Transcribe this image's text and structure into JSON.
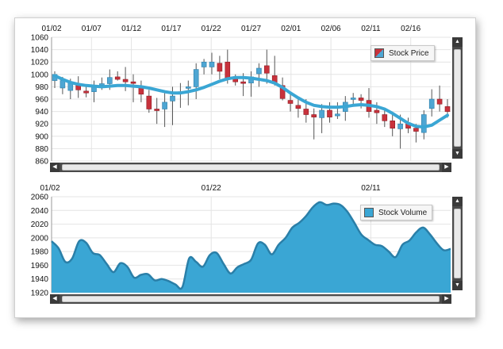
{
  "colors": {
    "up": "#4ea6d3",
    "down": "#c8323c",
    "trend": "#3aa6d4",
    "area": "#3aa6d4",
    "areaStroke": "#2a7fa8",
    "grid": "#e4e4e4",
    "wick": "#555555"
  },
  "icons": {
    "scroll_up": "triangle-up-icon",
    "scroll_down": "triangle-down-icon",
    "scroll_left": "triangle-left-icon",
    "scroll_right": "triangle-right-icon"
  },
  "controls": {
    "up_glyph": "▲",
    "down_glyph": "▼",
    "left_glyph": "◀",
    "right_glyph": "▶"
  },
  "chart_data": [
    {
      "type": "candlestick",
      "legend": "Stock Price",
      "legend_position": "top-right",
      "grid": true,
      "ylim": [
        860,
        1060
      ],
      "y_ticks": [
        860,
        880,
        900,
        920,
        940,
        960,
        980,
        1000,
        1020,
        1040,
        1060
      ],
      "x_tick_labels": [
        "01/02",
        "01/07",
        "01/12",
        "01/17",
        "01/22",
        "01/27",
        "02/01",
        "02/06",
        "02/11",
        "02/16"
      ],
      "candles": [
        {
          "o": 990,
          "c": 1000,
          "h": 1005,
          "l": 978
        },
        {
          "o": 978,
          "c": 990,
          "h": 996,
          "l": 968
        },
        {
          "o": 974,
          "c": 986,
          "h": 993,
          "l": 960
        },
        {
          "o": 982,
          "c": 975,
          "h": 997,
          "l": 962
        },
        {
          "o": 973,
          "c": 970,
          "h": 983,
          "l": 963
        },
        {
          "o": 972,
          "c": 980,
          "h": 990,
          "l": 955
        },
        {
          "o": 983,
          "c": 985,
          "h": 995,
          "l": 975
        },
        {
          "o": 985,
          "c": 995,
          "h": 1008,
          "l": 975
        },
        {
          "o": 996,
          "c": 992,
          "h": 1005,
          "l": 990
        },
        {
          "o": 992,
          "c": 988,
          "h": 1012,
          "l": 973
        },
        {
          "o": 988,
          "c": 986,
          "h": 1000,
          "l": 955
        },
        {
          "o": 980,
          "c": 968,
          "h": 990,
          "l": 955
        },
        {
          "o": 965,
          "c": 944,
          "h": 975,
          "l": 938
        },
        {
          "o": 944,
          "c": 943,
          "h": 962,
          "l": 920
        },
        {
          "o": 944,
          "c": 955,
          "h": 970,
          "l": 915
        },
        {
          "o": 957,
          "c": 965,
          "h": 980,
          "l": 918
        },
        {
          "o": 970,
          "c": 972,
          "h": 986,
          "l": 946
        },
        {
          "o": 979,
          "c": 980,
          "h": 990,
          "l": 950
        },
        {
          "o": 980,
          "c": 1008,
          "h": 1018,
          "l": 960
        },
        {
          "o": 1012,
          "c": 1020,
          "h": 1025,
          "l": 1000
        },
        {
          "o": 1012,
          "c": 1020,
          "h": 1035,
          "l": 1000
        },
        {
          "o": 1018,
          "c": 1005,
          "h": 1030,
          "l": 992
        },
        {
          "o": 1020,
          "c": 994,
          "h": 1040,
          "l": 985
        },
        {
          "o": 994,
          "c": 988,
          "h": 1000,
          "l": 982
        },
        {
          "o": 988,
          "c": 986,
          "h": 1002,
          "l": 965
        },
        {
          "o": 986,
          "c": 996,
          "h": 1005,
          "l": 964
        },
        {
          "o": 1001,
          "c": 1010,
          "h": 1018,
          "l": 980
        },
        {
          "o": 1014,
          "c": 1002,
          "h": 1040,
          "l": 985
        },
        {
          "o": 998,
          "c": 985,
          "h": 1030,
          "l": 982
        },
        {
          "o": 982,
          "c": 961,
          "h": 995,
          "l": 958
        },
        {
          "o": 958,
          "c": 953,
          "h": 968,
          "l": 940
        },
        {
          "o": 950,
          "c": 945,
          "h": 962,
          "l": 930
        },
        {
          "o": 944,
          "c": 935,
          "h": 960,
          "l": 922
        },
        {
          "o": 935,
          "c": 931,
          "h": 945,
          "l": 895
        },
        {
          "o": 930,
          "c": 942,
          "h": 952,
          "l": 905
        },
        {
          "o": 942,
          "c": 931,
          "h": 955,
          "l": 922
        },
        {
          "o": 933,
          "c": 936,
          "h": 955,
          "l": 928
        },
        {
          "o": 940,
          "c": 955,
          "h": 965,
          "l": 925
        },
        {
          "o": 962,
          "c": 962,
          "h": 970,
          "l": 948
        },
        {
          "o": 962,
          "c": 958,
          "h": 968,
          "l": 945
        },
        {
          "o": 958,
          "c": 940,
          "h": 978,
          "l": 930
        },
        {
          "o": 942,
          "c": 938,
          "h": 955,
          "l": 920
        },
        {
          "o": 935,
          "c": 925,
          "h": 945,
          "l": 915
        },
        {
          "o": 925,
          "c": 913,
          "h": 935,
          "l": 900
        },
        {
          "o": 912,
          "c": 920,
          "h": 935,
          "l": 880
        },
        {
          "o": 920,
          "c": 913,
          "h": 930,
          "l": 905
        },
        {
          "o": 913,
          "c": 908,
          "h": 920,
          "l": 890
        },
        {
          "o": 906,
          "c": 935,
          "h": 942,
          "l": 895
        },
        {
          "o": 945,
          "c": 960,
          "h": 976,
          "l": 932
        },
        {
          "o": 960,
          "c": 952,
          "h": 982,
          "l": 940
        },
        {
          "o": 948,
          "c": 940,
          "h": 960,
          "l": 930
        }
      ],
      "trend": [
        998,
        992,
        987,
        984,
        982,
        981,
        980,
        981,
        982,
        982,
        981,
        980,
        978,
        975,
        972,
        970,
        970,
        972,
        975,
        979,
        984,
        989,
        993,
        995,
        995,
        994,
        992,
        990,
        986,
        979,
        970,
        962,
        955,
        950,
        948,
        947,
        947,
        948,
        950,
        951,
        950,
        948,
        944,
        937,
        929,
        921,
        916,
        915,
        918,
        926,
        934
      ]
    },
    {
      "type": "area",
      "legend": "Stock Volume",
      "legend_position": "top-right",
      "grid": true,
      "ylim": [
        1920,
        2060
      ],
      "y_ticks": [
        1920,
        1940,
        1960,
        1980,
        2000,
        2020,
        2040,
        2060
      ],
      "x_tick_labels": [
        "01/02",
        "01/22",
        "02/11"
      ],
      "x_tick_index": [
        0,
        20,
        40
      ],
      "values": [
        1995,
        1985,
        1965,
        1970,
        1995,
        1993,
        1978,
        1975,
        1962,
        1950,
        1963,
        1958,
        1942,
        1946,
        1947,
        1938,
        1940,
        1937,
        1932,
        1928,
        1970,
        1965,
        1958,
        1975,
        1978,
        1962,
        1948,
        1957,
        1962,
        1968,
        1992,
        1990,
        1976,
        1990,
        2000,
        2015,
        2022,
        2032,
        2045,
        2052,
        2048,
        2050,
        2048,
        2038,
        2022,
        2005,
        1997,
        1990,
        1988,
        1980,
        1972,
        1990,
        1996,
        2008,
        2015,
        2005,
        1992,
        1982,
        1984
      ],
      "values_x_span": 50
    }
  ]
}
